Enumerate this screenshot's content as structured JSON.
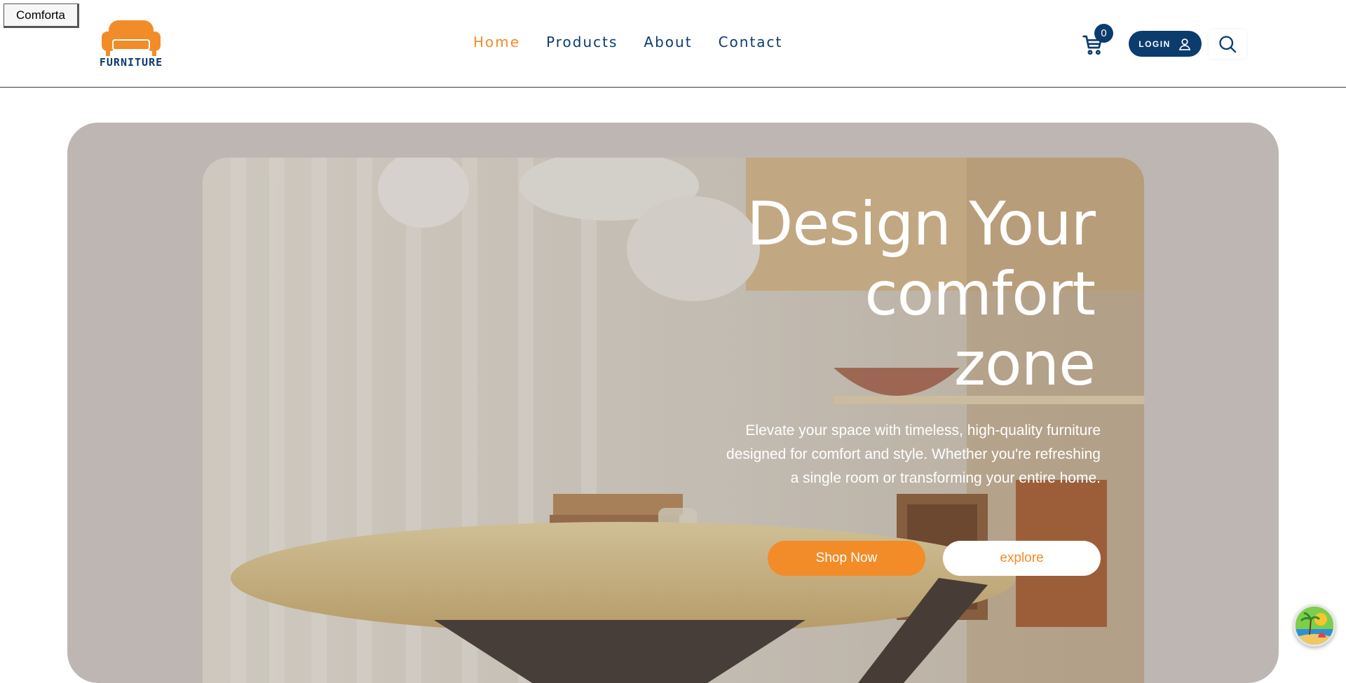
{
  "tooltip": {
    "label": "Comforta"
  },
  "logo": {
    "text": "FURNITURE",
    "icon": "sofa-icon",
    "color": "#f28c28"
  },
  "nav": {
    "items": [
      {
        "label": "Home",
        "active": true
      },
      {
        "label": "Products",
        "active": false
      },
      {
        "label": "About",
        "active": false
      },
      {
        "label": "Contact",
        "active": false
      }
    ]
  },
  "header": {
    "cart_count": "0",
    "login_label": "LOGIN",
    "cart_icon": "cart-icon",
    "user_icon": "user-icon",
    "search_icon": "search-icon"
  },
  "hero": {
    "title_line1": "Design Your",
    "title_line2": "comfort",
    "title_line3": "zone",
    "description": "Elevate your space with timeless, high-quality furniture designed for comfort and style. Whether you're refreshing a single room or transforming your entire home.",
    "primary_button": "Shop Now",
    "secondary_button": "explore"
  },
  "colors": {
    "brand_navy": "#0c3b6e",
    "accent_orange": "#f28c28",
    "hero_bg": "#bdb6b3"
  }
}
